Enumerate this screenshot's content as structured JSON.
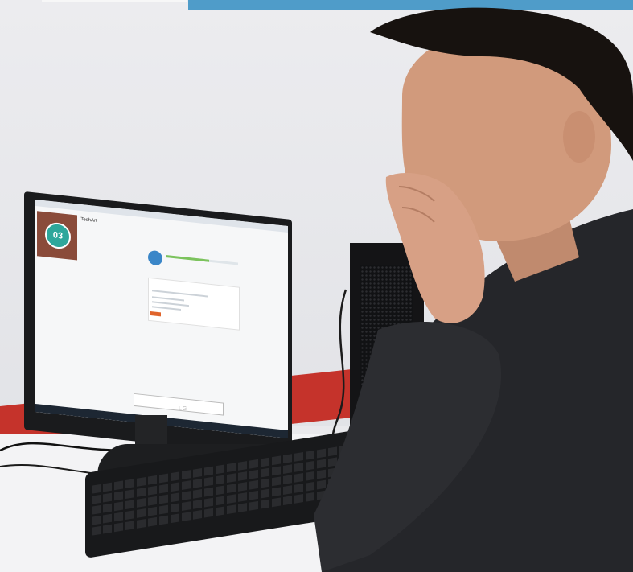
{
  "scene": {
    "description_elements": [
      "wall",
      "desk",
      "monitor",
      "keyboard",
      "pc-tower",
      "person"
    ]
  },
  "monitor_screen": {
    "brand": "iTechArt",
    "badge_number": "03",
    "monitor_logo": "LG",
    "progress_fraction": 0.6
  },
  "colors": {
    "wall": "#e9e9ec",
    "top_band": "#4f9cc9",
    "stripe": "#c5332b",
    "badge": "#2ea79b",
    "progress": "#7cc35d",
    "button": "#e0642b"
  }
}
